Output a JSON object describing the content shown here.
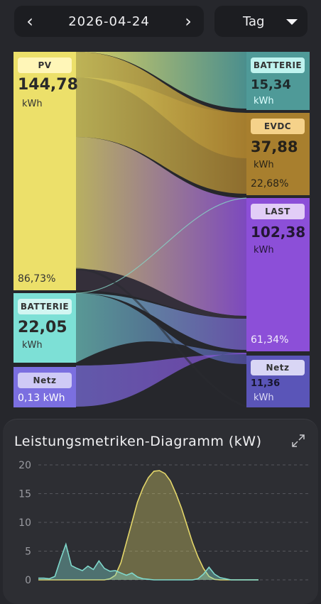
{
  "date_nav": {
    "prev_icon": "chevron-left-icon",
    "date": "2026-04-24",
    "next_icon": "chevron-right-icon",
    "prev_glyph": "‹",
    "next_glyph": "›"
  },
  "period": {
    "selected": "Tag",
    "icon": "caret-down-icon"
  },
  "sankey": {
    "sources": [
      {
        "label": "PV",
        "value": "144,78",
        "unit": "kWh",
        "percent": "86,73%",
        "color": "#ece06a"
      },
      {
        "label": "BATTERIE",
        "value": "22,05",
        "unit": "kWh",
        "color": "#7de0d6"
      },
      {
        "label": "Netz",
        "value": "0,13",
        "unit": "kWh",
        "color": "#7b6fe0"
      }
    ],
    "targets": [
      {
        "label": "BATTERIE",
        "value": "15,34",
        "unit": "kWh",
        "color": "#4f9a98"
      },
      {
        "label": "EVDC",
        "value": "37,88",
        "unit": "kWh",
        "percent": "22,68%",
        "color": "#a87f2e"
      },
      {
        "label": "LAST",
        "value": "102,38",
        "unit": "kWh",
        "percent": "61,34%",
        "color": "#8c4fd8"
      },
      {
        "label": "Netz",
        "value": "11,36",
        "unit": "kWh",
        "color": "#5a55b8"
      }
    ]
  },
  "chart_panel": {
    "title": "Leistungsmetriken-Diagramm (kW)",
    "expand_icon": "expand-icon"
  },
  "chart_data": {
    "type": "line",
    "title": "Leistungsmetriken-Diagramm (kW)",
    "ylabel": "",
    "xlabel": "",
    "ylim": [
      0,
      20
    ],
    "yticks": [
      0,
      5,
      10,
      15,
      20
    ],
    "grid": true,
    "series": [
      {
        "color": "#e3d66a",
        "x": [
          0,
          1,
          2,
          3,
          4,
          5,
          6,
          7,
          8,
          9,
          10,
          11,
          12,
          13,
          14,
          15,
          16,
          17,
          18,
          19,
          20,
          21,
          22,
          23,
          24,
          25,
          26,
          27,
          28,
          29,
          30,
          31,
          32,
          33,
          34,
          35,
          36,
          37,
          38,
          39,
          40
        ],
        "y": [
          0,
          0,
          0,
          0,
          0,
          0,
          0,
          0,
          0,
          0,
          0,
          0,
          0,
          0.2,
          0.8,
          3,
          6.5,
          10,
          13.5,
          16,
          17.8,
          18.9,
          19,
          18.5,
          17.2,
          15,
          12.5,
          9.5,
          6.5,
          4,
          2,
          0.6,
          0.1,
          0,
          0,
          0,
          0,
          0,
          0,
          0,
          0
        ]
      },
      {
        "color": "#7fd8cc",
        "x": [
          0,
          1,
          2,
          3,
          4,
          5,
          6,
          7,
          8,
          9,
          10,
          11,
          12,
          13,
          14,
          15,
          16,
          17,
          18,
          19,
          20,
          21,
          22,
          23,
          24,
          25,
          26,
          27,
          28,
          29,
          30,
          31,
          32,
          33,
          34,
          35,
          36,
          37,
          38,
          39,
          40
        ],
        "y": [
          0.3,
          0.3,
          0.2,
          0.6,
          3.5,
          6.2,
          2.5,
          2,
          1.6,
          2.4,
          1.8,
          3.3,
          2,
          1.5,
          1.6,
          1.2,
          0.8,
          1.2,
          0.5,
          0.2,
          0.1,
          0,
          0,
          0,
          0,
          0,
          0,
          0,
          0,
          0.2,
          1,
          2.2,
          1,
          0.4,
          0.2,
          0,
          0,
          0,
          0,
          0,
          0
        ]
      }
    ]
  }
}
